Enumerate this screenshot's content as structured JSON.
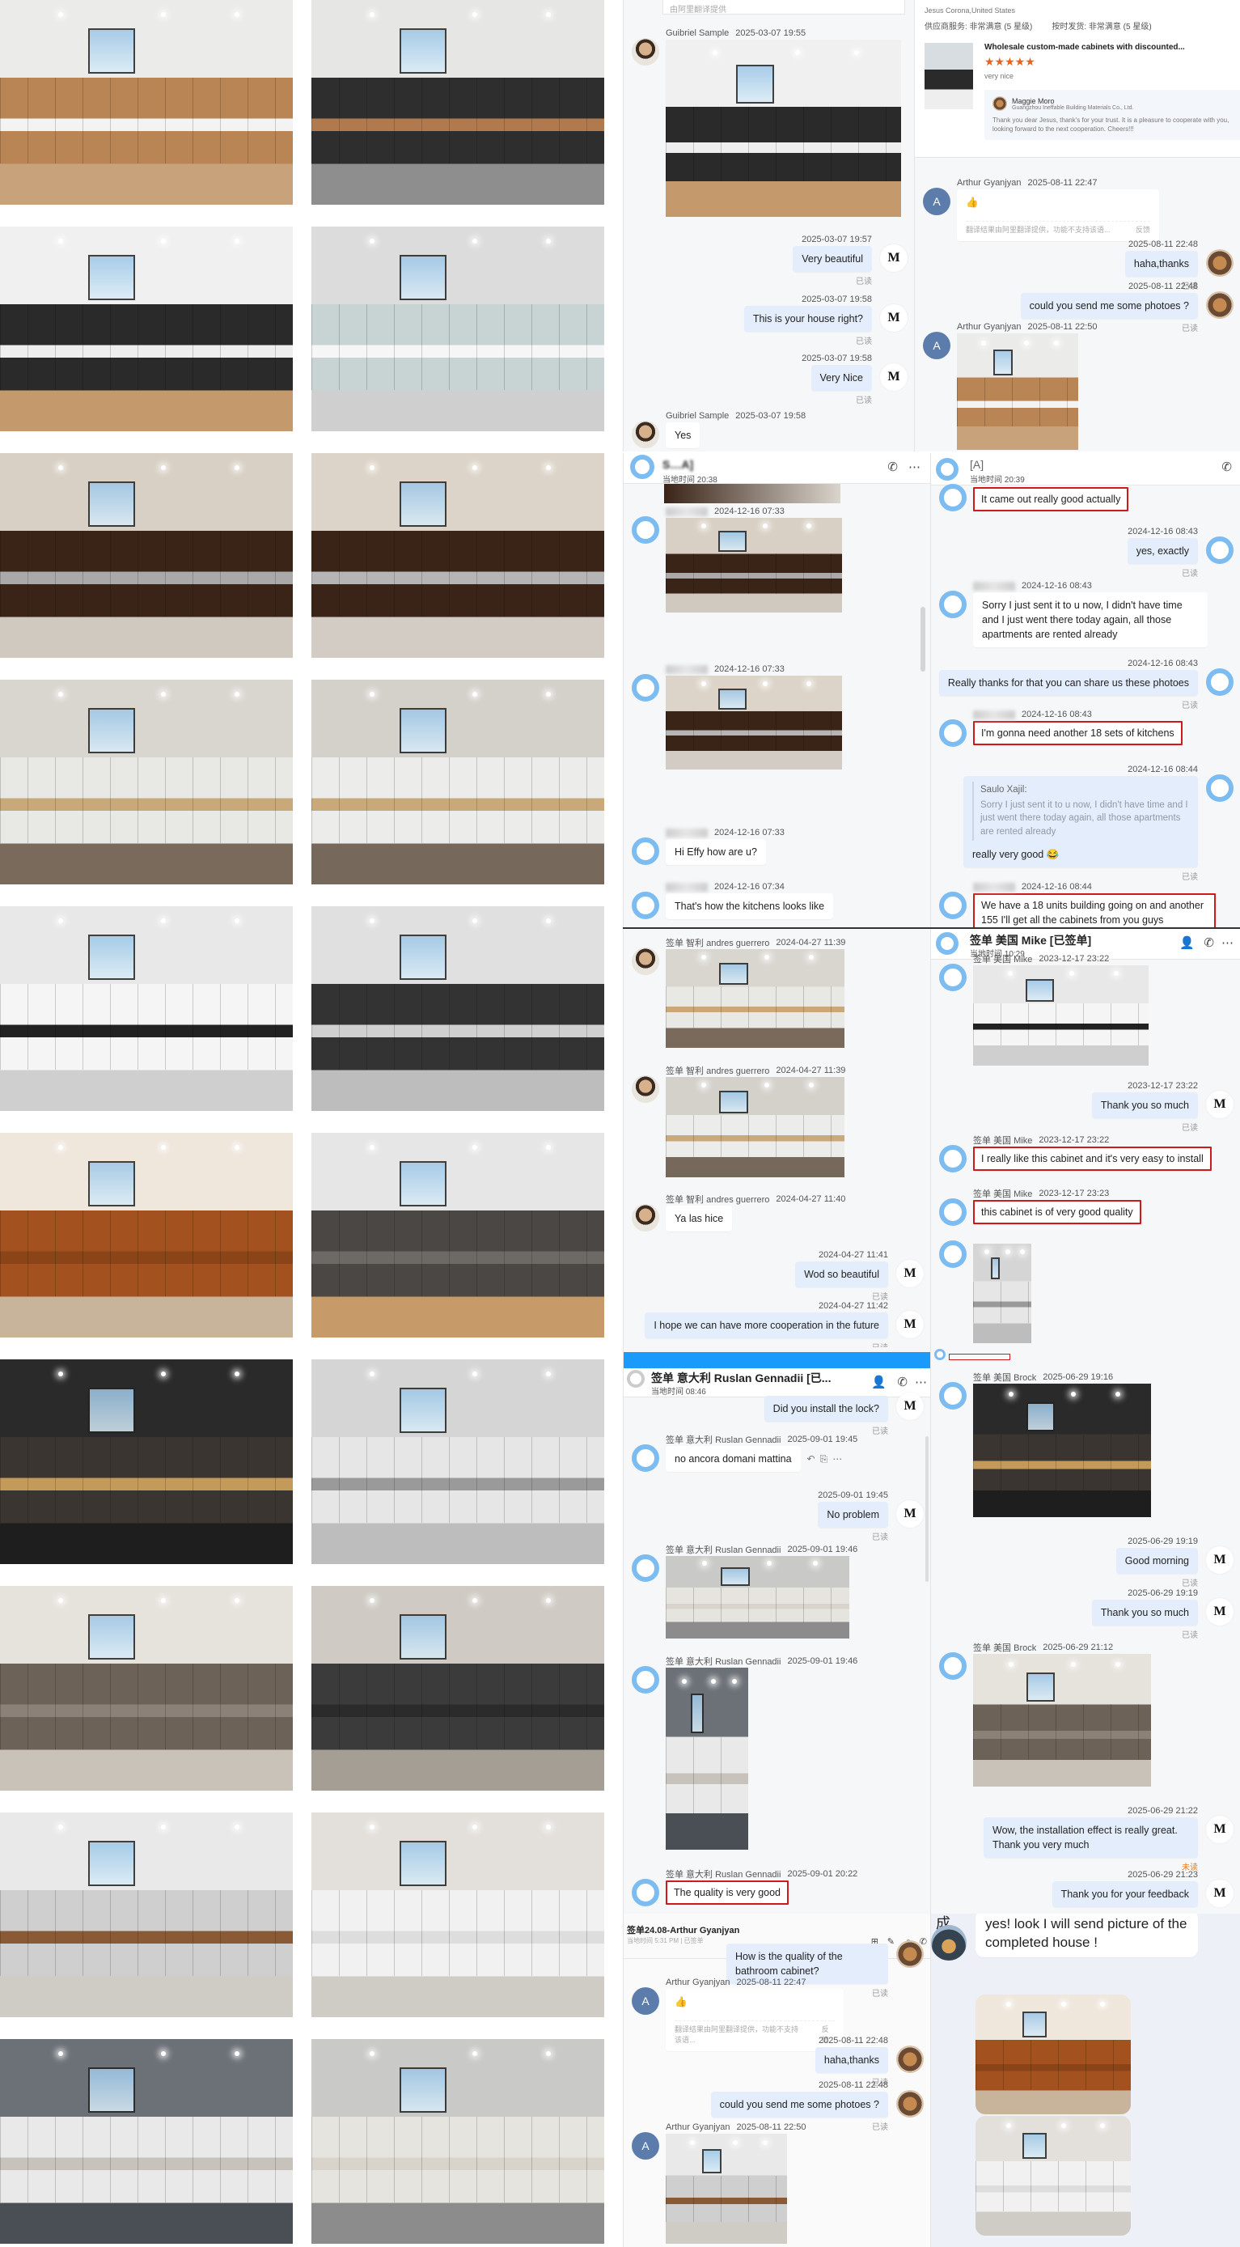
{
  "photos": [
    {
      "colors": [
        "#ebebe9",
        "#b98555",
        "#f3f3f3",
        "#c8a27a"
      ]
    },
    {
      "colors": [
        "#e6e6e4",
        "#2e2e2e",
        "#b07a4e",
        "#8e8e8e"
      ]
    },
    {
      "colors": [
        "#f0f0f0",
        "#2a2a2a",
        "#eeeeee",
        "#c49a6c"
      ]
    },
    {
      "colors": [
        "#dcdcdc",
        "#c8d4d4",
        "#f6f6f6",
        "#cfcfcf"
      ]
    },
    {
      "colors": [
        "#d8d0c4",
        "#3a2418",
        "#a9a9a9",
        "#cfc9c0"
      ]
    },
    {
      "colors": [
        "#dcd4c8",
        "#3a2418",
        "#b5b5b5",
        "#d2ccc4"
      ]
    },
    {
      "colors": [
        "#d9d6d0",
        "#e8e8e4",
        "#c9a97a",
        "#7a6a5c"
      ]
    },
    {
      "colors": [
        "#d4d1cb",
        "#ececea",
        "#c9a97a",
        "#76685a"
      ]
    },
    {
      "colors": [
        "#e8e8e8",
        "#f5f5f5",
        "#222222",
        "#cfcfcf"
      ]
    },
    {
      "colors": [
        "#e0e0e0",
        "#333333",
        "#d0d0d0",
        "#bdbdbd"
      ]
    },
    {
      "colors": [
        "#efe6dc",
        "#a3521f",
        "#8a4418",
        "#c8b49a"
      ]
    },
    {
      "colors": [
        "#e6e6e6",
        "#4a4744",
        "#6d6a66",
        "#c79a6a"
      ]
    },
    {
      "colors": [
        "#2a2a2a",
        "#3a3530",
        "#c49a5a",
        "#1e1e1e"
      ]
    },
    {
      "colors": [
        "#d5d5d5",
        "#e6e6e6",
        "#9a9a9a",
        "#bdbdbd"
      ]
    },
    {
      "colors": [
        "#e6e2dc",
        "#6d6258",
        "#8b8178",
        "#c9c2b9"
      ]
    },
    {
      "colors": [
        "#cfcbc4",
        "#3b3b3b",
        "#2b2b2b",
        "#a49e94"
      ]
    },
    {
      "colors": [
        "#e9e9e9",
        "#cfcfcf",
        "#8a5a36",
        "#cfcbc5"
      ]
    },
    {
      "colors": [
        "#e3e0dc",
        "#f1f1f1",
        "#dddddd",
        "#cfcbc5"
      ]
    },
    {
      "colors": [
        "#6c7177",
        "#e9e9e9",
        "#c7c2bb",
        "#4a4f55"
      ]
    },
    {
      "colors": [
        "#c9c9c7",
        "#e6e4df",
        "#d8d4cc",
        "#8c8c8c"
      ]
    }
  ],
  "colors": {
    "highlight": "#d0191b",
    "bubble_out": "#e4edfb",
    "accent_blue": "#1a9bfc",
    "unread": "#f07a14"
  },
  "headers": {
    "p1": {
      "hint": "由阿里翻译提供"
    },
    "p3": {
      "title": "S…A]",
      "subtitle": "当地时间 20:38"
    },
    "p4": {
      "title": "[A]",
      "subtitle": "当地时间 20:39"
    },
    "p6": {
      "title": "签单 美国 Mike [已签单]",
      "subtitle": "当地时间 10:29"
    },
    "p7": {
      "title": "签单 意大利 Ruslan Gennadii [已...",
      "subtitle": "当地时间 08:46"
    },
    "p9": {
      "title": "签单24.08-Arthur Gyanjyan",
      "subtitle": "当地时间 5:31 PM | 已签单"
    },
    "p10": {
      "char": "成",
      "text": "yes! look I will send picture of the completed house !"
    }
  },
  "review": {
    "buyer": "Jesus Corona,United States",
    "rating1": "供应商服务: 非常满意 (5 星级)",
    "rating2": "按时发货: 非常满意 (5 星级)",
    "product": "Wholesale custom-made cabinets with discounted...",
    "stars": "★★★★★",
    "comment": "very nice",
    "seller": "Maggie Moro",
    "company": "Guangzhou Ineffable Building Materials Co., Ltd.",
    "reply": "Thank you dear Jesus, thank's for your trust. It is a pleasure to cooperate with you, looking forward to the next cooperation. Cheers!!!"
  },
  "chats": {
    "p1": {
      "messages": [
        {
          "dir": "in",
          "av": "face",
          "name": "Guibriel Sample",
          "time": "2025-03-07 19:55",
          "photo": 2
        },
        {
          "dir": "out",
          "av": "logo",
          "av_letter": "M",
          "time": "2025-03-07 19:57",
          "text": "Very beautiful",
          "read": "已读"
        },
        {
          "dir": "out",
          "av": "logo",
          "av_letter": "M",
          "time": "2025-03-07 19:58",
          "text": "This is your house right?",
          "read": "已读"
        },
        {
          "dir": "out",
          "av": "logo",
          "av_letter": "M",
          "time": "2025-03-07 19:58",
          "text": "Very Nice",
          "read": "已读"
        },
        {
          "dir": "in",
          "av": "face",
          "name": "Guibriel Sample",
          "time": "2025-03-07 19:58",
          "text": "Yes"
        }
      ]
    },
    "p2": {
      "messages": [
        {
          "dir": "in",
          "av": "A",
          "av_letter": "A",
          "name": "Arthur Gyanjyan",
          "time": "2025-08-11 22:47",
          "text": "👍",
          "note": "翻译结果由阿里翻译提供，功能不支持该语...",
          "feedback": "反馈"
        },
        {
          "dir": "out",
          "av": "photo",
          "time": "2025-08-11 22:48",
          "text": "haha,thanks",
          "read": "已读"
        },
        {
          "dir": "out",
          "av": "photo",
          "time": "2025-08-11 22:48",
          "text": "could you send me some photoes ?",
          "read": "已读"
        },
        {
          "dir": "in",
          "av": "A",
          "av_letter": "A",
          "name": "Arthur Gyanjyan",
          "time": "2025-08-11 22:50",
          "photo": 0
        }
      ]
    },
    "p3": {
      "messages": [
        {
          "dir": "in",
          "av": "ring",
          "blur": true,
          "time": "2024-12-16 07:33",
          "photo": 4
        },
        {
          "dir": "in",
          "av": "ring",
          "blur": true,
          "time": "2024-12-16 07:33",
          "photo": 5
        },
        {
          "dir": "in",
          "av": "ring",
          "blur": true,
          "time": "2024-12-16 07:33",
          "text": "Hi Effy how are u?"
        },
        {
          "dir": "in",
          "av": "ring",
          "blur": true,
          "time": "2024-12-16 07:34",
          "text": "That's how the kitchens looks like"
        }
      ]
    },
    "p4": {
      "messages": [
        {
          "dir": "in",
          "av": "ring",
          "text": "It came out really good actually",
          "hl": true
        },
        {
          "dir": "out",
          "av": "ring",
          "time": "2024-12-16 08:43",
          "text": "yes, exactly",
          "read": "已读"
        },
        {
          "dir": "in",
          "av": "ring",
          "blur": true,
          "time": "2024-12-16 08:43",
          "text": "Sorry I just sent it to u now, I didn't have time and I just went there today again, all those apartments are rented already"
        },
        {
          "dir": "out",
          "av": "ring",
          "time": "2024-12-16 08:43",
          "text": "Really thanks for that you can share us these photoes",
          "read": "已读"
        },
        {
          "dir": "in",
          "av": "ring",
          "blur": true,
          "time": "2024-12-16 08:43",
          "text": "I'm gonna need another 18 sets of kitchens",
          "hl": true
        },
        {
          "dir": "out",
          "av": "ring",
          "time": "2024-12-16 08:44",
          "quote_name": "Saulo Xajil:",
          "quote": "Sorry I just sent it to u now, I didn't have time and I just went there today again, all those apartments are rented already",
          "text": "really very good 😂",
          "read": "已读"
        },
        {
          "dir": "in",
          "av": "ring",
          "blur": true,
          "time": "2024-12-16 08:44",
          "text": "We have a 18 units building going on and another 155 I'll get all the cabinets from you guys",
          "hl": true
        }
      ]
    },
    "p5": {
      "messages": [
        {
          "dir": "in",
          "av": "face",
          "name": "签单 智利 andres guerrero",
          "time": "2024-04-27 11:39",
          "photo": 6
        },
        {
          "dir": "in",
          "av": "face",
          "name": "签单 智利 andres guerrero",
          "time": "2024-04-27 11:39",
          "photo": 7
        },
        {
          "dir": "in",
          "av": "face",
          "name": "签单 智利 andres guerrero",
          "time": "2024-04-27 11:40",
          "text": "Ya las hice"
        },
        {
          "dir": "out",
          "av": "logo",
          "av_letter": "M",
          "time": "2024-04-27 11:41",
          "text": "Wod so beautiful",
          "read": "已读"
        },
        {
          "dir": "out",
          "av": "logo",
          "av_letter": "M",
          "time": "2024-04-27 11:42",
          "text": "I hope we can have more cooperation in the future",
          "read": "已读"
        }
      ]
    },
    "p6": {
      "messages": [
        {
          "dir": "in",
          "av": "ring",
          "name": "签单 美国 Mike",
          "time": "2023-12-17 23:22",
          "photo": 8
        },
        {
          "dir": "out",
          "av": "logo",
          "av_letter": "M",
          "time": "2023-12-17 23:22",
          "text": "Thank you so much",
          "read": "已读"
        },
        {
          "dir": "in",
          "av": "ring",
          "name": "签单 美国 Mike",
          "time": "2023-12-17 23:22",
          "text": "I really like this cabinet and it's very easy to install",
          "hl": true
        },
        {
          "dir": "in",
          "av": "ring",
          "name": "签单 美国 Mike",
          "time": "2023-12-17 23:23",
          "text": "this cabinet is of very good quality",
          "hl": true
        },
        {
          "dir": "in",
          "av": "ring",
          "photo": 13
        }
      ]
    },
    "p7": {
      "messages": [
        {
          "dir": "out",
          "av": "logo",
          "av_letter": "M",
          "text": "Did you install the lock?",
          "read": "已读"
        },
        {
          "dir": "in",
          "av": "ring",
          "name": "签单 意大利 Ruslan Gennadii",
          "time": "2025-09-01 19:45",
          "text": "no ancora domani mattina",
          "actions": true
        },
        {
          "dir": "out",
          "av": "logo",
          "av_letter": "M",
          "time": "2025-09-01 19:45",
          "text": "No problem",
          "read": "已读"
        },
        {
          "dir": "in",
          "av": "ring",
          "name": "签单 意大利 Ruslan Gennadii",
          "time": "2025-09-01 19:46",
          "photo": 19
        },
        {
          "dir": "in",
          "av": "ring",
          "name": "签单 意大利 Ruslan Gennadii",
          "time": "2025-09-01 19:46",
          "photo": 18
        },
        {
          "dir": "in",
          "av": "ring",
          "name": "签单 意大利 Ruslan Gennadii",
          "time": "2025-09-01 20:22",
          "text": "The quality is very good",
          "hl": true
        }
      ]
    },
    "p8": {
      "messages": [
        {
          "dir": "in",
          "av": "ring",
          "name": "签单 美国 Brock",
          "time": "2025-06-29 19:16",
          "photo": 12
        },
        {
          "dir": "out",
          "av": "logo",
          "av_letter": "M",
          "time": "2025-06-29 19:19",
          "text": "Good morning",
          "read": "已读"
        },
        {
          "dir": "out",
          "av": "logo",
          "av_letter": "M",
          "time": "2025-06-29 19:19",
          "text": "Thank you so much",
          "read": "已读"
        },
        {
          "dir": "in",
          "av": "ring",
          "name": "签单 美国 Brock",
          "time": "2025-06-29 21:12",
          "photo": 14
        },
        {
          "dir": "out",
          "av": "logo",
          "av_letter": "M",
          "time": "2025-06-29 21:22",
          "text": "Wow, the installation effect is really great. Thank you very much",
          "read": "未读",
          "unread": true
        },
        {
          "dir": "out",
          "av": "logo",
          "av_letter": "M",
          "time": "2025-06-29 21:23",
          "text": "Thank you for your feedback"
        }
      ]
    },
    "p9": {
      "messages": [
        {
          "dir": "out",
          "av": "photo",
          "text": "How is the quality of the bathroom cabinet?",
          "read": "已读"
        },
        {
          "dir": "in",
          "av": "A",
          "av_letter": "A",
          "name": "Arthur Gyanjyan",
          "time": "2025-08-11 22:47",
          "text": "👍",
          "note": "翻译结果由阿里翻译提供，功能不支持该语...",
          "feedback": "反馈"
        },
        {
          "dir": "out",
          "av": "photo",
          "time": "2025-08-11 22:48",
          "text": "haha,thanks",
          "read": "已读"
        },
        {
          "dir": "out",
          "av": "photo",
          "time": "2025-08-11 22:48",
          "text": "could you send me some photoes ?",
          "read": "已读"
        },
        {
          "dir": "in",
          "av": "A",
          "av_letter": "A",
          "name": "Arthur Gyanjyan",
          "time": "2025-08-11 22:50",
          "photo": 16
        }
      ]
    },
    "p10": {
      "messages": [
        {
          "dir": "in",
          "photo": 10
        },
        {
          "dir": "in",
          "photo": 17
        }
      ]
    }
  }
}
